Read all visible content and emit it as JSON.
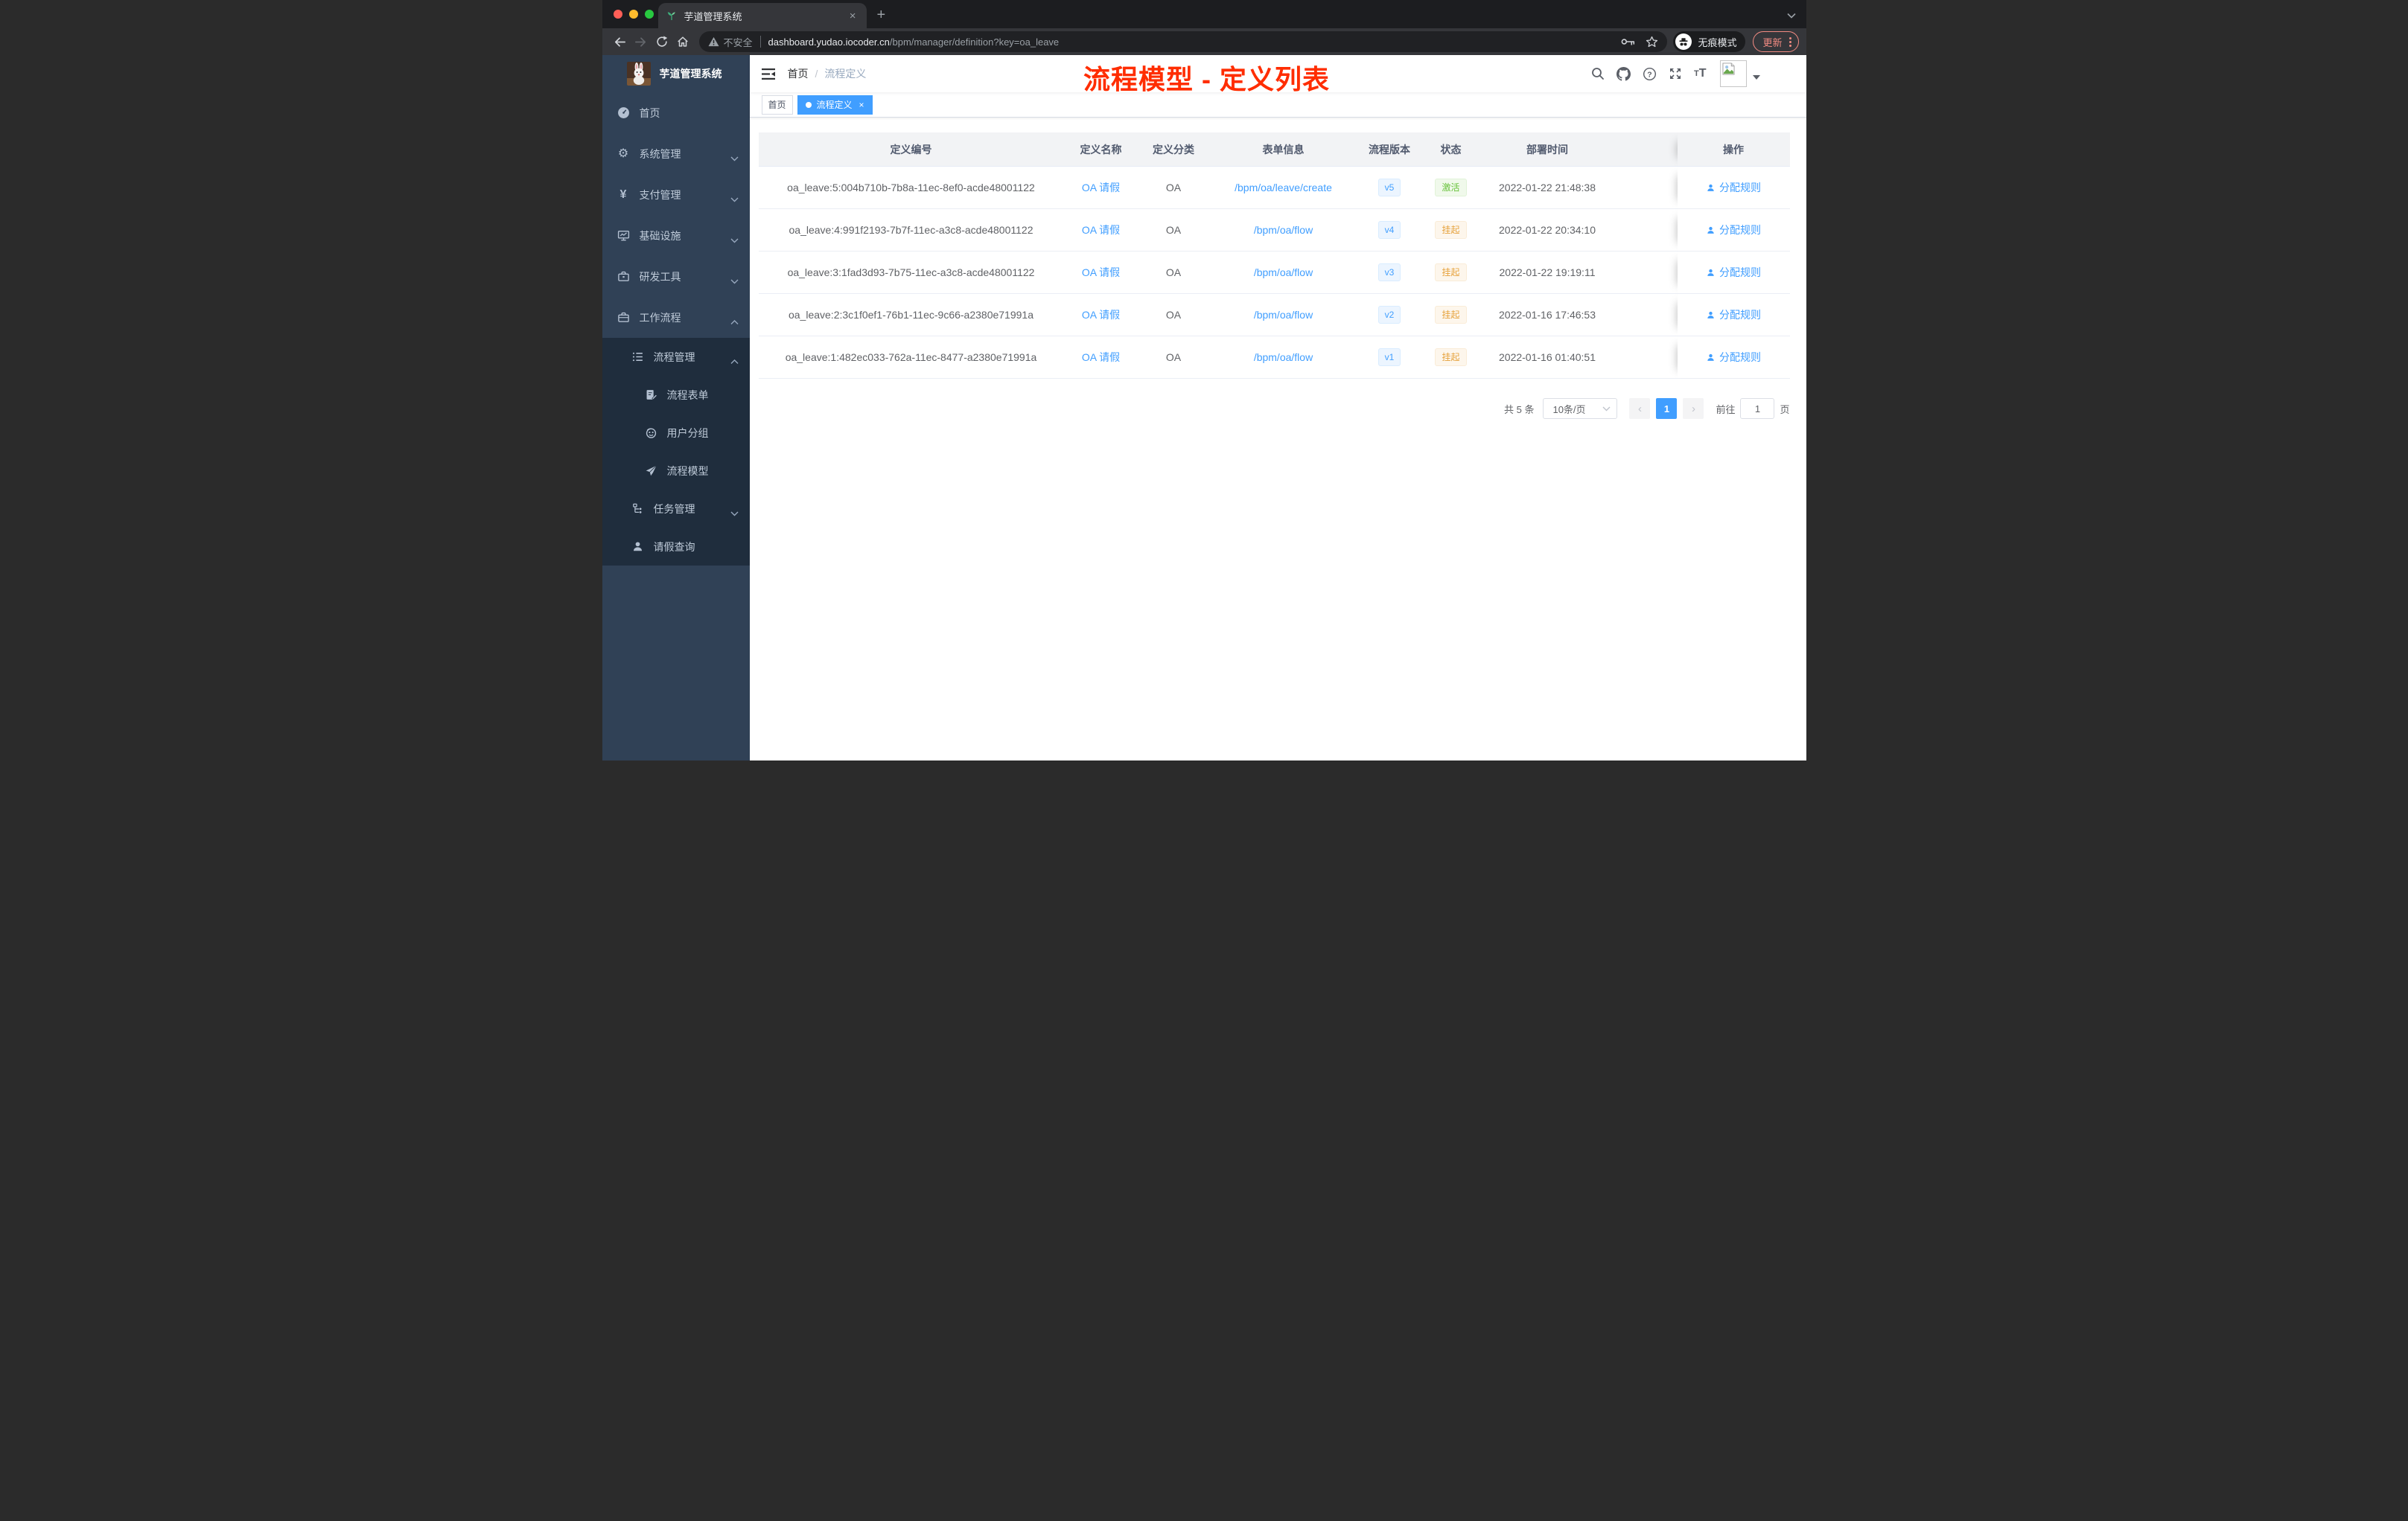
{
  "colors": {
    "accent": "#409eff",
    "success": "#67c23a",
    "warning": "#e6a23c",
    "annotation_red": "#ff2d00",
    "sidebar_bg": "#304156",
    "submenu_bg": "#1f2d3d",
    "active_tag_bg": "#409eff"
  },
  "icons": {
    "sprout-icon": "green sprout favicon",
    "dashboard-icon": "speedometer",
    "gear-icon": "⚙",
    "yen-icon": "¥",
    "monitor-icon": "monitor with chart",
    "toolbox-icon": "toolbox",
    "briefcase-icon": "briefcase",
    "list-icon": "list lines with dots",
    "form-icon": "document with pencil",
    "robot-icon": "robot face",
    "plane-icon": "paper plane",
    "tree-icon": "org tree",
    "user-icon": "person silhouette",
    "search-icon": "magnifier",
    "github-icon": "octocat",
    "help-icon": "question circle",
    "fullscreen-icon": "expand arrows",
    "fontsize-icon": "tT",
    "avatar": "broken image placeholder",
    "incognito-icon": "spy hat and glasses",
    "key-icon": "key",
    "star-icon": "bookmark star",
    "warning-icon": "warning triangle"
  },
  "browser": {
    "tab": {
      "title": "芋道管理系统",
      "close_glyph": "×",
      "new_tab_glyph": "+"
    },
    "toolbar": {
      "security_label": "不安全",
      "url_host": "dashboard.yudao.iocoder.cn",
      "url_path": "/bpm/manager/definition?key=oa_leave",
      "incognito_label": "无痕模式",
      "update_label": "更新"
    }
  },
  "sidebar": {
    "title": "芋道管理系统",
    "items": [
      {
        "icon": "dashboard-icon",
        "label": "首页",
        "level": 1
      },
      {
        "icon": "gear-icon",
        "label": "系统管理",
        "level": 1,
        "arrow": "down"
      },
      {
        "icon": "yen-icon",
        "label": "支付管理",
        "level": 1,
        "arrow": "down"
      },
      {
        "icon": "monitor-icon",
        "label": "基础设施",
        "level": 1,
        "arrow": "down"
      },
      {
        "icon": "toolbox-icon",
        "label": "研发工具",
        "level": 1,
        "arrow": "down"
      },
      {
        "icon": "briefcase-icon",
        "label": "工作流程",
        "level": 1,
        "arrow": "up"
      },
      {
        "icon": "list-icon",
        "label": "流程管理",
        "level": 2,
        "arrow": "up"
      },
      {
        "icon": "form-icon",
        "label": "流程表单",
        "level": 3
      },
      {
        "icon": "robot-icon",
        "label": "用户分组",
        "level": 3
      },
      {
        "icon": "plane-icon",
        "label": "流程模型",
        "level": 3
      },
      {
        "icon": "tree-icon",
        "label": "任务管理",
        "level": 2,
        "arrow": "down"
      },
      {
        "icon": "user-icon",
        "label": "请假查询",
        "level": 2
      }
    ]
  },
  "navbar": {
    "breadcrumb": {
      "home": "首页",
      "separator": "/",
      "current": "流程定义"
    },
    "annotation": "流程模型 - 定义列表"
  },
  "tags_bar": {
    "tags": [
      {
        "label": "首页",
        "active": false
      },
      {
        "label": "流程定义",
        "active": true,
        "close_glyph": "×"
      }
    ]
  },
  "table": {
    "headers": {
      "id": "定义编号",
      "name": "定义名称",
      "category": "定义分类",
      "form": "表单信息",
      "version": "流程版本",
      "status": "状态",
      "deployed": "部署时间",
      "action": "操作"
    },
    "rows": [
      {
        "id": "oa_leave:5:004b710b-7b8a-11ec-8ef0-acde48001122",
        "name": "OA 请假",
        "category": "OA",
        "form": "/bpm/oa/leave/create",
        "version": "v5",
        "status": "激活",
        "status_type": "success",
        "deployed": "2022-01-22 21:48:38",
        "action": "分配规则"
      },
      {
        "id": "oa_leave:4:991f2193-7b7f-11ec-a3c8-acde48001122",
        "name": "OA 请假",
        "category": "OA",
        "form": "/bpm/oa/flow",
        "version": "v4",
        "status": "挂起",
        "status_type": "warning",
        "deployed": "2022-01-22 20:34:10",
        "action": "分配规则"
      },
      {
        "id": "oa_leave:3:1fad3d93-7b75-11ec-a3c8-acde48001122",
        "name": "OA 请假",
        "category": "OA",
        "form": "/bpm/oa/flow",
        "version": "v3",
        "status": "挂起",
        "status_type": "warning",
        "deployed": "2022-01-22 19:19:11",
        "action": "分配规则"
      },
      {
        "id": "oa_leave:2:3c1f0ef1-76b1-11ec-9c66-a2380e71991a",
        "name": "OA 请假",
        "category": "OA",
        "form": "/bpm/oa/flow",
        "version": "v2",
        "status": "挂起",
        "status_type": "warning",
        "deployed": "2022-01-16 17:46:53",
        "action": "分配规则"
      },
      {
        "id": "oa_leave:1:482ec033-762a-11ec-8477-a2380e71991a",
        "name": "OA 请假",
        "category": "OA",
        "form": "/bpm/oa/flow",
        "version": "v1",
        "status": "挂起",
        "status_type": "warning",
        "deployed": "2022-01-16 01:40:51",
        "action": "分配规则"
      }
    ]
  },
  "pagination": {
    "total": "共 5 条",
    "page_size": "10条/页",
    "prev": "‹",
    "page": "1",
    "next": "›",
    "goto_label": "前往",
    "goto_value": "1",
    "goto_unit": "页"
  }
}
